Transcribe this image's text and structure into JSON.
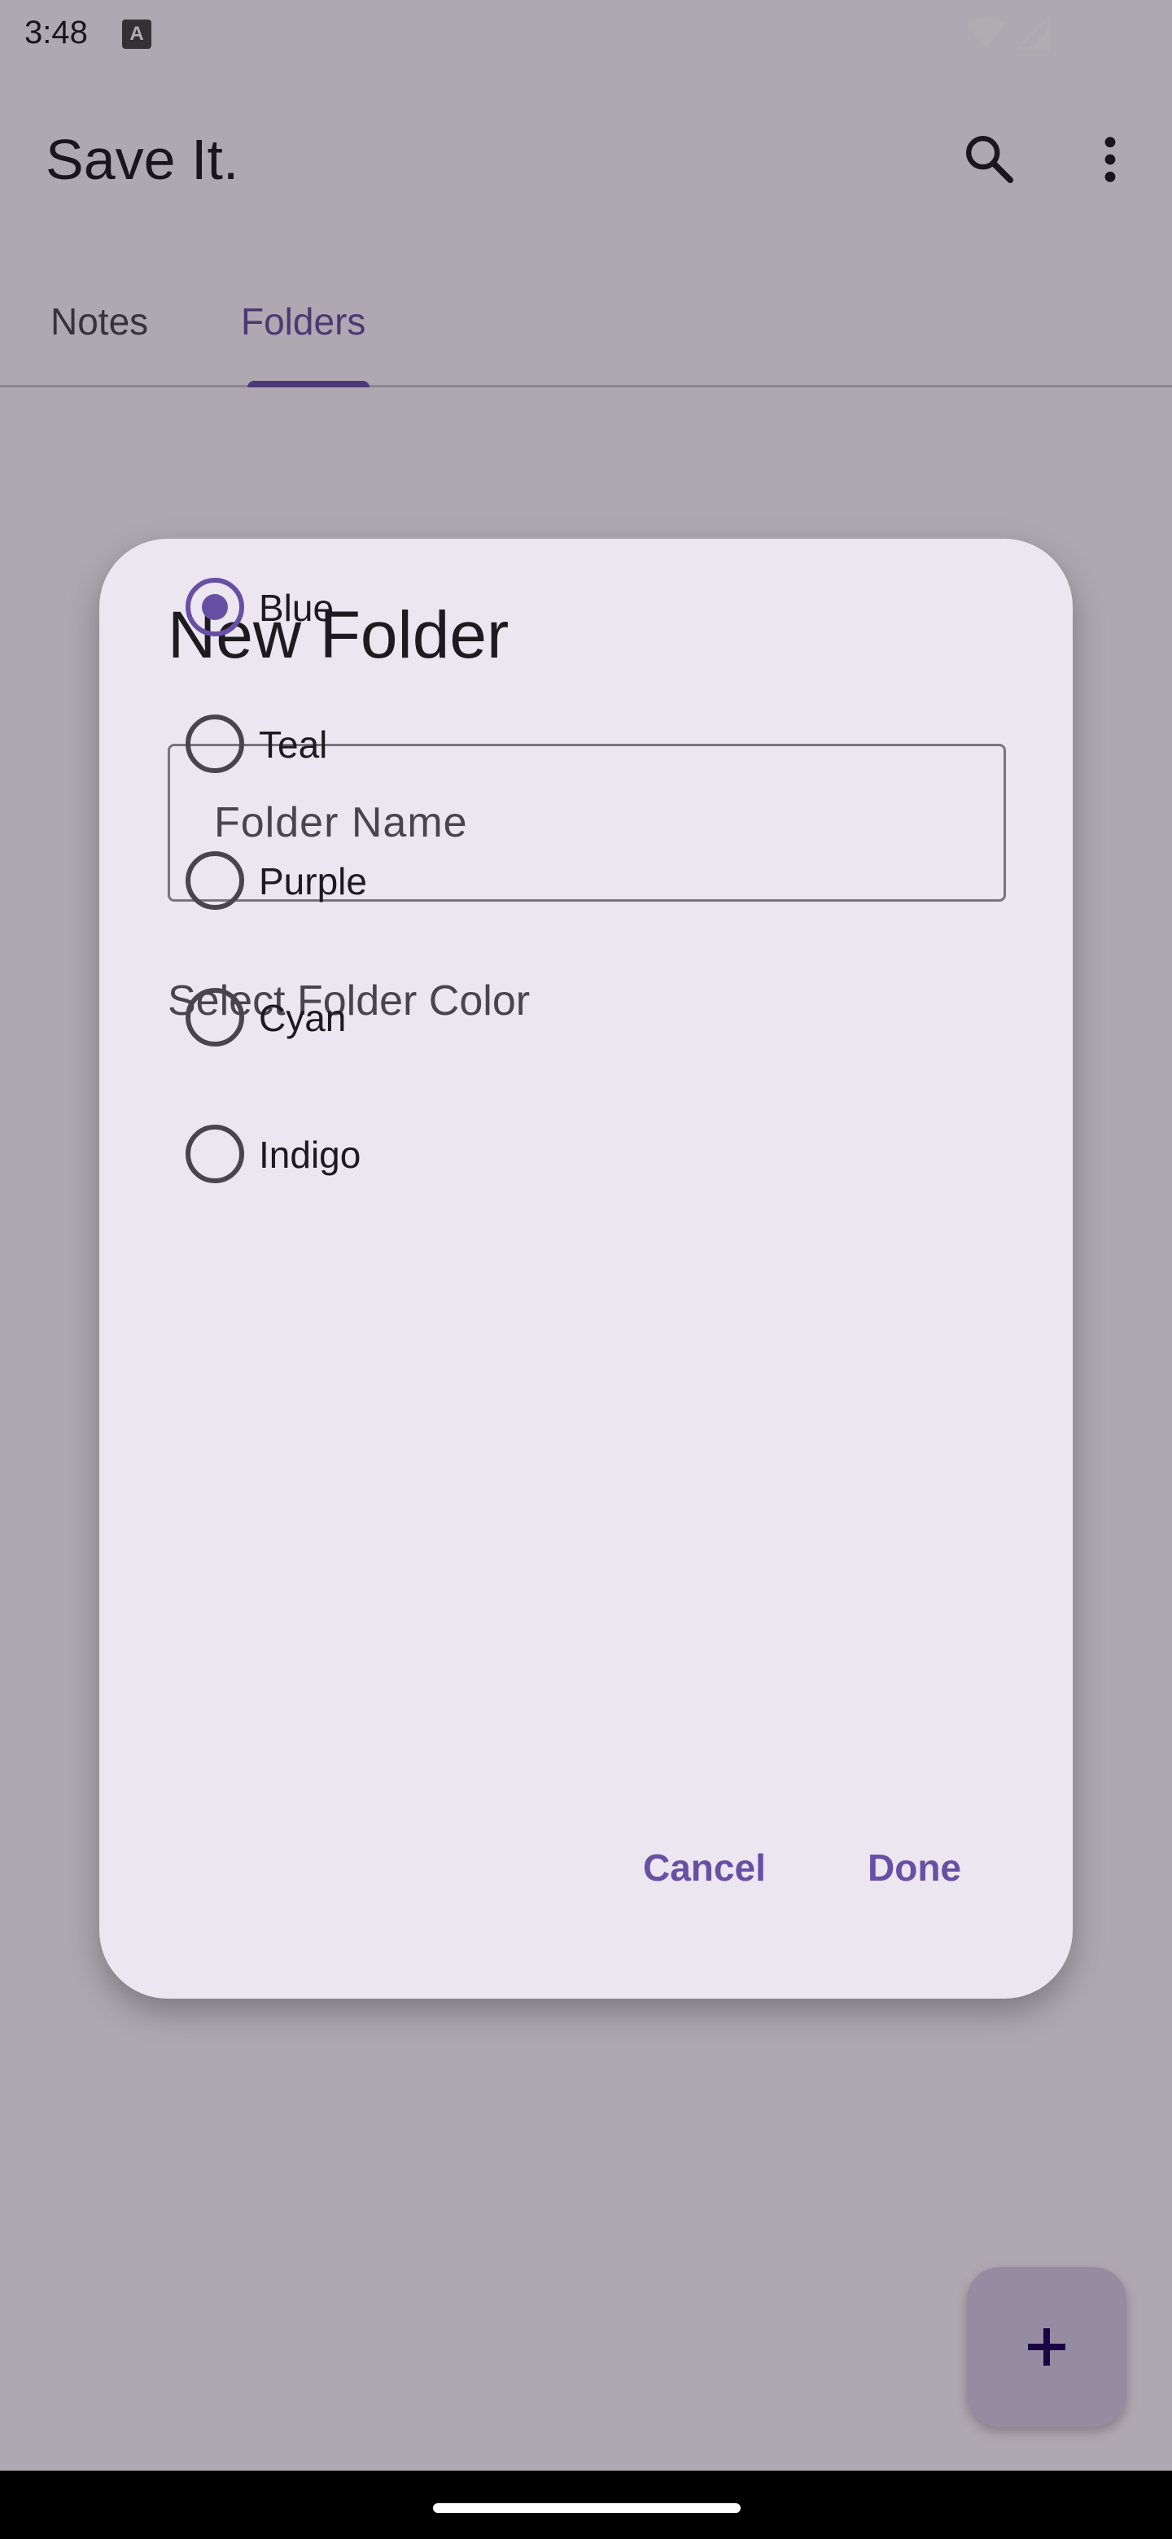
{
  "status_bar": {
    "time": "3:48",
    "notification_icon": "A"
  },
  "app_bar": {
    "title": "Save It.",
    "search_icon": "search-icon",
    "menu_icon": "more-vert-icon"
  },
  "tabs": [
    {
      "label": "Notes",
      "selected": false
    },
    {
      "label": "Folders",
      "selected": true
    }
  ],
  "dialog": {
    "title": "New Folder",
    "folder_name": {
      "value": "",
      "placeholder": "Folder Name"
    },
    "color_label": "Select Folder Color",
    "colors": [
      {
        "label": "Blue",
        "selected": true
      },
      {
        "label": "Teal",
        "selected": false
      },
      {
        "label": "Purple",
        "selected": false
      },
      {
        "label": "Cyan",
        "selected": false
      },
      {
        "label": "Indigo",
        "selected": false
      }
    ],
    "cancel_label": "Cancel",
    "done_label": "Done"
  },
  "fab": {
    "icon": "plus-icon"
  },
  "theme": {
    "primary": "#6750a4",
    "surface": "#ece6f0",
    "fab": "#d9cde8"
  }
}
